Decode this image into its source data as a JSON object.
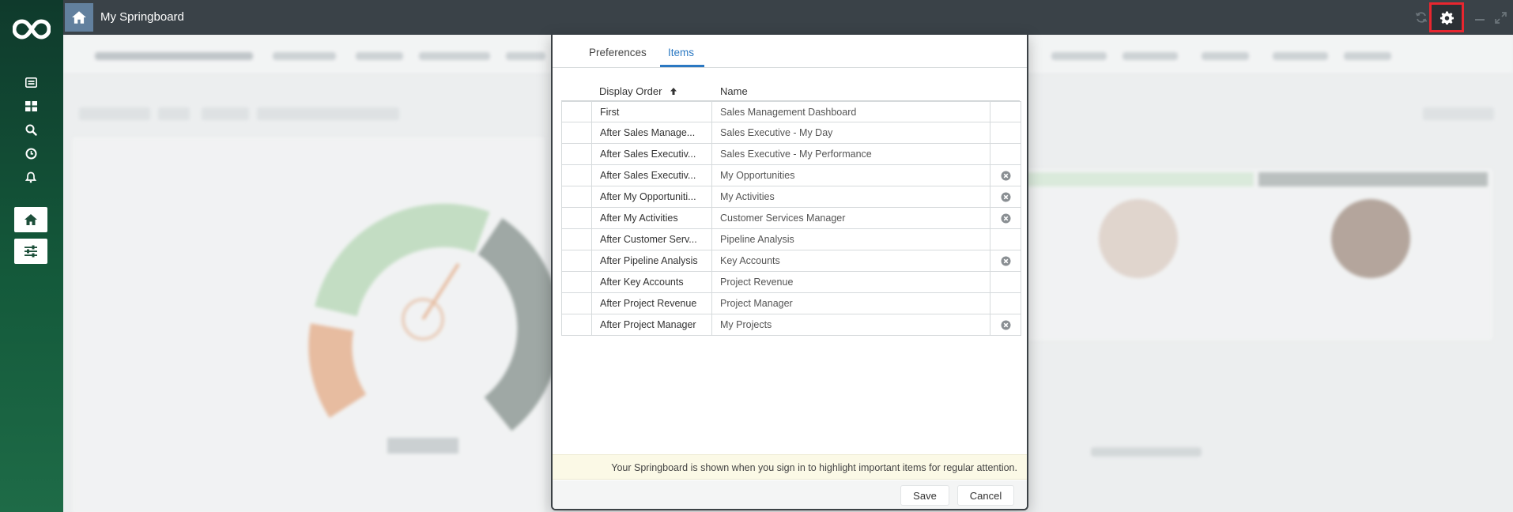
{
  "topbar": {
    "title": "My Springboard"
  },
  "modal": {
    "tabs": [
      {
        "label": "Preferences",
        "active": false
      },
      {
        "label": "Items",
        "active": true
      }
    ],
    "columns": {
      "display_order": "Display Order",
      "name": "Name"
    },
    "rows": [
      {
        "order": "First",
        "name": "Sales Management Dashboard",
        "removable": false
      },
      {
        "order": "After Sales Manage...",
        "name": "Sales Executive - My Day",
        "removable": false
      },
      {
        "order": "After Sales Executiv...",
        "name": "Sales Executive - My Performance",
        "removable": false
      },
      {
        "order": "After Sales Executiv...",
        "name": "My Opportunities",
        "removable": true
      },
      {
        "order": "After My Opportuniti...",
        "name": "My Activities",
        "removable": true
      },
      {
        "order": "After My Activities",
        "name": "Customer Services Manager",
        "removable": true
      },
      {
        "order": "After Customer Serv...",
        "name": "Pipeline Analysis",
        "removable": false
      },
      {
        "order": "After Pipeline Analysis",
        "name": "Key Accounts",
        "removable": true
      },
      {
        "order": "After Key Accounts",
        "name": "Project Revenue",
        "removable": false
      },
      {
        "order": "After Project Revenue",
        "name": "Project Manager",
        "removable": false
      },
      {
        "order": "After Project Manager",
        "name": "My Projects",
        "removable": true
      }
    ],
    "info": "Your Springboard is shown when you sign in to highlight important items for regular attention.",
    "save_label": "Save",
    "cancel_label": "Cancel"
  },
  "colors": {
    "accent": "#2b78c2",
    "highlight": "#e8262f",
    "sidebar": "#145a3b",
    "topbar": "#3a4248"
  },
  "icons": {
    "sidebar": [
      "infinity-logo-icon",
      "news-icon",
      "dashboard-icon",
      "search-icon",
      "clock-icon",
      "bell-icon",
      "home-icon",
      "sliders-icon"
    ],
    "topbar": [
      "home-icon",
      "refresh-icon",
      "gear-icon",
      "minimize-icon",
      "expand-icon"
    ],
    "row": "remove-circle-icon",
    "sort": "arrow-up-icon"
  }
}
